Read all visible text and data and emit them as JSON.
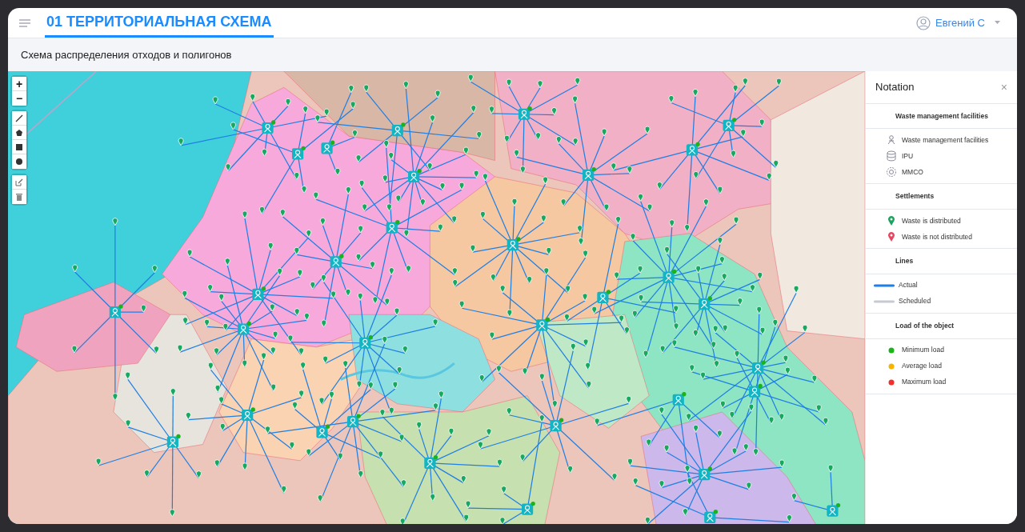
{
  "header": {
    "tabs": [
      {
        "label": "01 ТЕРРИТОРИАЛЬНАЯ СХЕМА",
        "selected": true
      }
    ],
    "user": "Евгений С"
  },
  "page_title": "Схема распределения отходов и полигонов",
  "map": {
    "zoom_in": "+",
    "zoom_out": "−"
  },
  "legend": {
    "title": "Notation",
    "close": "×",
    "sections": [
      {
        "title": "Waste management facilities",
        "items": [
          {
            "kind": "facility",
            "label": "Waste management facilities"
          },
          {
            "kind": "ipu",
            "label": "IPU"
          },
          {
            "kind": "mmco",
            "label": "MMCO"
          }
        ]
      },
      {
        "title": "Settlements",
        "items": [
          {
            "kind": "pin",
            "label": "Waste is distributed",
            "color": "#1aa35c"
          },
          {
            "kind": "pin",
            "label": "Waste is not distributed",
            "color": "#e8455f"
          }
        ]
      },
      {
        "title": "Lines",
        "items": [
          {
            "kind": "line",
            "label": "Actual",
            "color": "#1f7fe3"
          },
          {
            "kind": "line",
            "label": "Scheduled",
            "color": "#c5cad3"
          }
        ]
      },
      {
        "title": "Load of the object",
        "items": [
          {
            "kind": "dot",
            "label": "Minimum load",
            "color": "#1bb31b"
          },
          {
            "kind": "dot",
            "label": "Average load",
            "color": "#f5b400"
          },
          {
            "kind": "dot",
            "label": "Maximum load",
            "color": "#f0302c"
          }
        ]
      }
    ]
  }
}
